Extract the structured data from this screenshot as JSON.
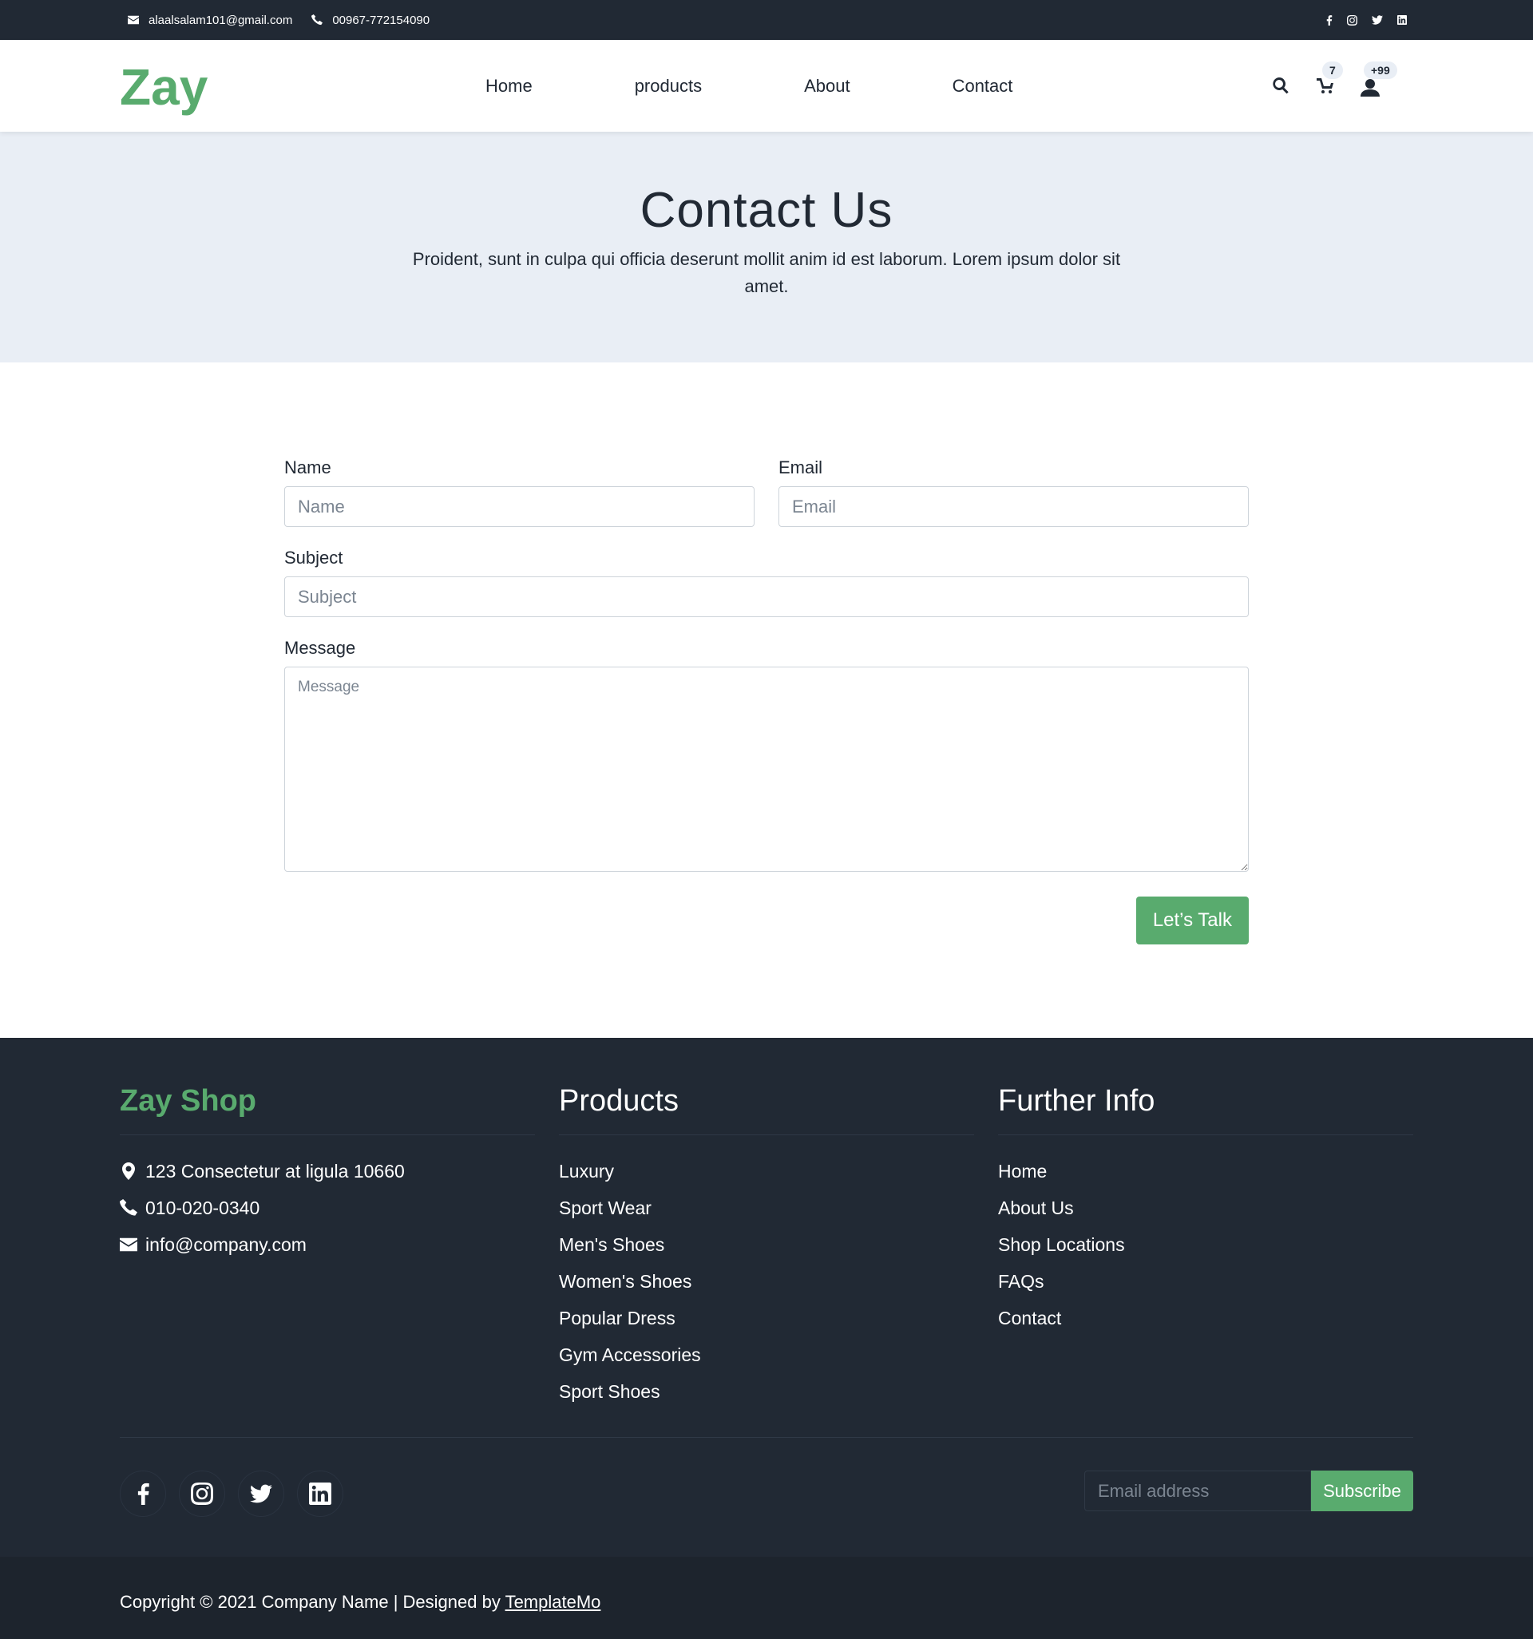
{
  "topbar": {
    "email": "alaalsalam101@gmail.com",
    "phone": "00967-772154090",
    "social_icons": [
      "facebook-icon",
      "instagram-icon",
      "twitter-icon",
      "linkedin-icon"
    ]
  },
  "nav": {
    "logo": "Zay",
    "links": [
      "Home",
      "products",
      "About",
      "Contact"
    ],
    "cart_count": "7",
    "user_count": "+99"
  },
  "hero": {
    "title": "Contact Us",
    "subtitle": "Proident, sunt in culpa qui officia deserunt mollit anim id est laborum. Lorem ipsum dolor sit amet."
  },
  "form": {
    "name_label": "Name",
    "name_placeholder": "Name",
    "email_label": "Email",
    "email_placeholder": "Email",
    "subject_label": "Subject",
    "subject_placeholder": "Subject",
    "message_label": "Message",
    "message_placeholder": "Message",
    "submit_label": "Let’s Talk"
  },
  "footer": {
    "shop": {
      "title": "Zay Shop",
      "address": "123 Consectetur at ligula 10660",
      "phone": "010-020-0340",
      "email": "info@company.com"
    },
    "products": {
      "title": "Products",
      "items": [
        "Luxury",
        "Sport Wear",
        "Men's Shoes",
        "Women's Shoes",
        "Popular Dress",
        "Gym Accessories",
        "Sport Shoes"
      ]
    },
    "info": {
      "title": "Further Info",
      "items": [
        "Home",
        "About Us",
        "Shop Locations",
        "FAQs",
        "Contact"
      ]
    },
    "subscribe_placeholder": "Email address",
    "subscribe_label": "Subscribe",
    "copyright_text": "Copyright © 2021 Company Name | Designed by ",
    "copyright_link": "TemplateMo"
  },
  "colors": {
    "accent": "#59ab6e",
    "dark": "#212934",
    "hero_bg": "#e9eef5"
  }
}
